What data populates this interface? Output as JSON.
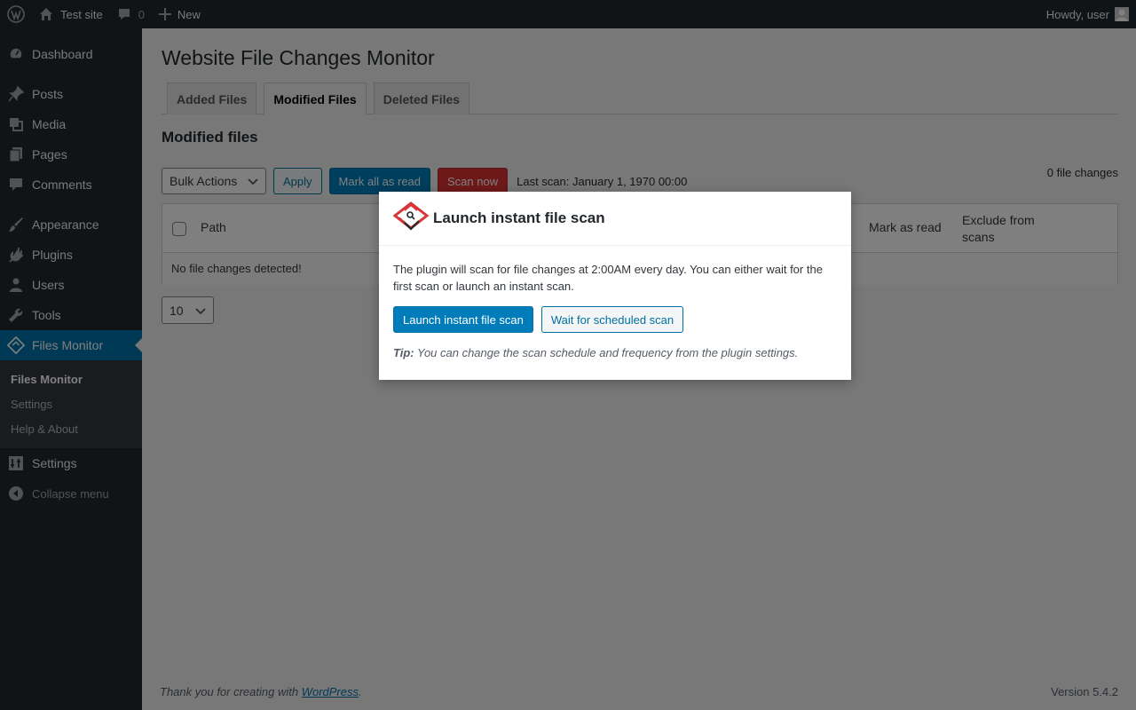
{
  "adminbar": {
    "site_name": "Test site",
    "comments_count": "0",
    "new_label": "New",
    "howdy": "Howdy, user"
  },
  "sidebar": {
    "items": [
      {
        "label": "Dashboard",
        "icon": "dashboard-icon"
      },
      {
        "label": "Posts",
        "icon": "pin-icon"
      },
      {
        "label": "Media",
        "icon": "media-icon"
      },
      {
        "label": "Pages",
        "icon": "pages-icon"
      },
      {
        "label": "Comments",
        "icon": "comment-icon"
      },
      {
        "label": "Appearance",
        "icon": "brush-icon"
      },
      {
        "label": "Plugins",
        "icon": "plug-icon"
      },
      {
        "label": "Users",
        "icon": "user-icon"
      },
      {
        "label": "Tools",
        "icon": "wrench-icon"
      },
      {
        "label": "Files Monitor",
        "icon": "files-monitor-icon"
      },
      {
        "label": "Settings",
        "icon": "settings-icon"
      }
    ],
    "submenu": [
      "Files Monitor",
      "Settings",
      "Help & About"
    ],
    "collapse_label": "Collapse menu"
  },
  "page": {
    "title": "Website File Changes Monitor",
    "tabs": [
      "Added Files",
      "Modified Files",
      "Deleted Files"
    ],
    "section_title": "Modified files",
    "bulk_actions": "Bulk Actions",
    "apply": "Apply",
    "mark_all_read": "Mark all as read",
    "scan_now": "Scan now",
    "last_scan": "Last scan: January 1, 1970 00:00",
    "file_changes": "0 file changes",
    "columns": {
      "path": "Path",
      "mark_as_read": "Mark as read",
      "exclude": "Exclude from scans"
    },
    "empty_message": "No file changes detected!",
    "per_page": "10"
  },
  "footer": {
    "thanks_prefix": "Thank you for creating with",
    "wordpress_link": "WordPress",
    "thanks_suffix": ".",
    "version": "Version 5.4.2"
  },
  "modal": {
    "title": "Launch instant file scan",
    "text": "The plugin will scan for file changes at 2:00AM every day. You can either wait for the first scan or launch an instant scan.",
    "launch_button": "Launch instant file scan",
    "wait_button": "Wait for scheduled scan",
    "tip_label": "Tip:",
    "tip_text": "You can change the scan schedule and frequency from the plugin settings."
  },
  "colors": {
    "admin_dark": "#23282d",
    "primary_blue": "#007cba",
    "danger_red": "#dc3232",
    "logo_red": "#d63638"
  }
}
